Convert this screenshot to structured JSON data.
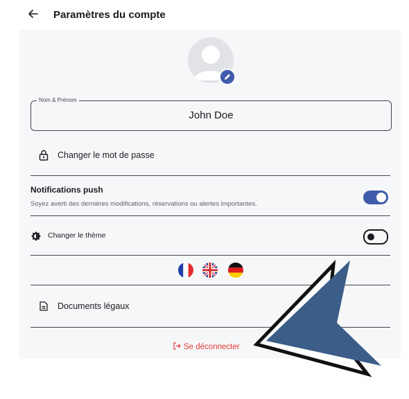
{
  "header": {
    "title": "Paramètres du compte",
    "back_icon": "arrow-back-icon"
  },
  "profile": {
    "avatar_icon": "person-avatar-icon",
    "edit_icon": "edit-pencil-icon"
  },
  "name_field": {
    "label": "Nom & Prénom",
    "value": "John Doe"
  },
  "password": {
    "label": "Changer le mot de passe",
    "icon": "lock-icon"
  },
  "notifications": {
    "title": "Notifications push",
    "subtitle": "Soyez averti des dernières modifications, réservations ou alertes importantes.",
    "enabled": true
  },
  "theme": {
    "label": "Changer le thème",
    "icon": "brightness-icon",
    "enabled": false
  },
  "languages": [
    {
      "code": "fr",
      "icon": "france-flag-icon"
    },
    {
      "code": "en",
      "icon": "uk-flag-icon"
    },
    {
      "code": "de",
      "icon": "germany-flag-icon"
    }
  ],
  "legal": {
    "label": "Documents légaux",
    "icon": "document-icon"
  },
  "logout": {
    "label": "Se déconnecter",
    "icon": "logout-icon"
  },
  "colors": {
    "accent": "#3f5ba9",
    "danger": "#e53935",
    "card_bg": "#f6f7f9",
    "cursor": "#3b5d87"
  }
}
